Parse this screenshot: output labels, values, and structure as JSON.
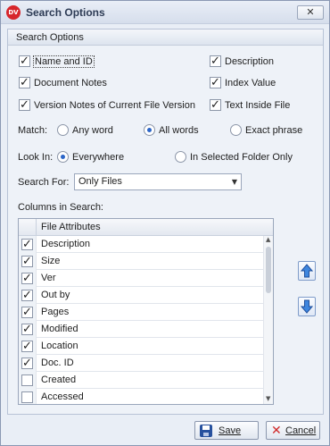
{
  "window": {
    "title": "Search Options",
    "logo_text": "DV",
    "close_glyph": "✕"
  },
  "section": {
    "header": "Search Options"
  },
  "options": {
    "name_and_id": "Name and ID",
    "description": "Description",
    "document_notes": "Document Notes",
    "index_value": "Index Value",
    "version_notes": "Version Notes of Current File Version",
    "text_inside_file": "Text Inside File"
  },
  "match": {
    "label": "Match:",
    "options": [
      "Any word",
      "All words",
      "Exact phrase"
    ],
    "selected": "All words"
  },
  "look_in": {
    "label": "Look In:",
    "options": [
      "Everywhere",
      "In Selected Folder Only"
    ],
    "selected": "Everywhere"
  },
  "search_for": {
    "label": "Search For:",
    "value": "Only Files"
  },
  "columns": {
    "label": "Columns in Search:",
    "header": "File Attributes",
    "rows": [
      {
        "name": "Description",
        "checked": true
      },
      {
        "name": "Size",
        "checked": true
      },
      {
        "name": "Ver",
        "checked": true
      },
      {
        "name": "Out by",
        "checked": true
      },
      {
        "name": "Pages",
        "checked": true
      },
      {
        "name": "Modified",
        "checked": true
      },
      {
        "name": "Location",
        "checked": true
      },
      {
        "name": "Doc. ID",
        "checked": true
      },
      {
        "name": "Created",
        "checked": false
      },
      {
        "name": "Accessed",
        "checked": false
      }
    ]
  },
  "buttons": {
    "save": "Save",
    "cancel": "Cancel"
  },
  "icons": {
    "move_up": "up-arrow-icon",
    "move_down": "down-arrow-icon",
    "save": "floppy-disk-icon",
    "cancel": "cancel-x-icon"
  },
  "colors": {
    "accent": "#2c66c8",
    "logo": "#d7262b",
    "cancel_icon": "#d02a2a"
  }
}
